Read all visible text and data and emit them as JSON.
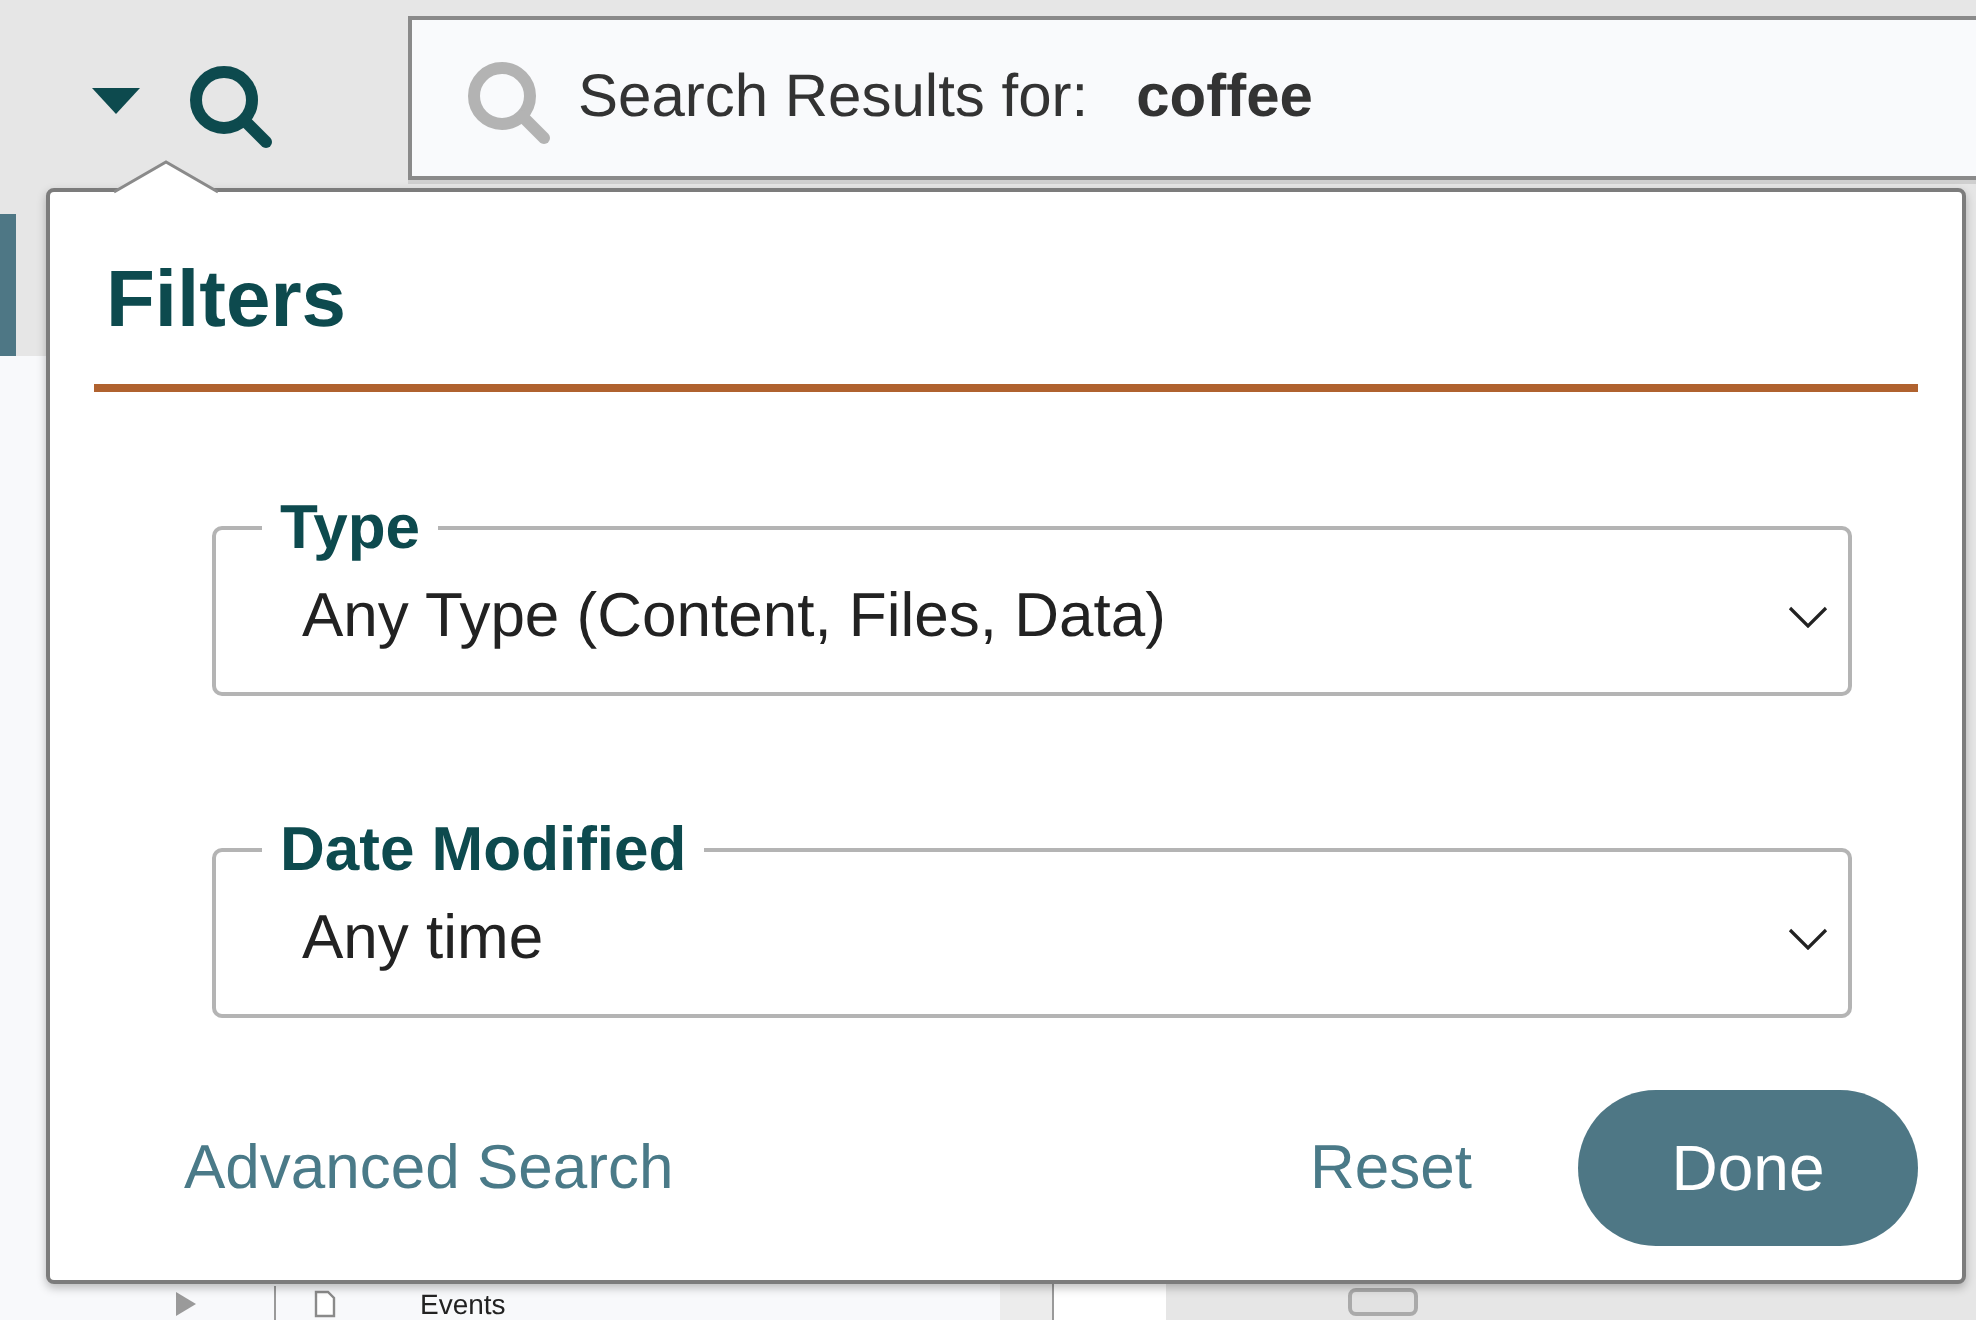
{
  "toolbar": {
    "search": {
      "label": "Search Results for:",
      "query": "coffee"
    }
  },
  "sidebar": {
    "items": [
      {
        "selected": true
      }
    ],
    "tree": [
      {
        "label": "Events",
        "expanded": false
      }
    ]
  },
  "filters": {
    "title": "Filters",
    "fields": [
      {
        "label": "Type",
        "value": "Any Type (Content, Files, Data)"
      },
      {
        "label": "Date Modified",
        "value": "Any time"
      }
    ],
    "advanced_link": "Advanced Search",
    "buttons": [
      {
        "label": "Reset",
        "kind": "text"
      },
      {
        "label": "Done",
        "kind": "primary"
      }
    ]
  }
}
